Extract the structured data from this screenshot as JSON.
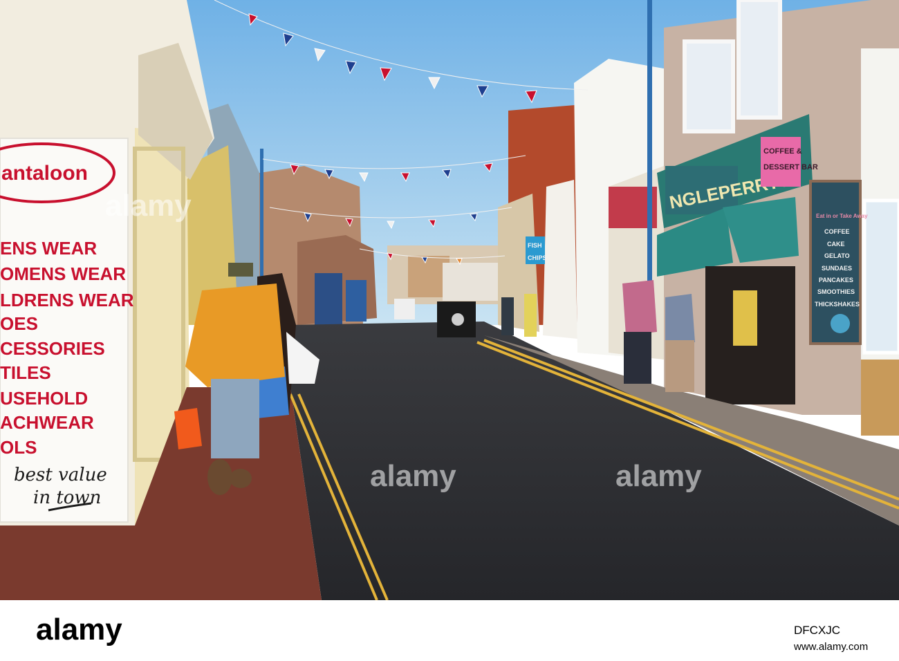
{
  "scene": {
    "left_shop_sign": {
      "name": "antaloon",
      "departments": [
        "ENS WEAR",
        "OMENS WEAR",
        "LDRENS WEAR",
        "OES",
        "CESSORIES",
        "TILES",
        "USEHOLD",
        "ACHWEAR",
        "OLS"
      ],
      "slogan_line1": "best value",
      "slogan_line2": "in town"
    },
    "cafe_sign": {
      "name": "NGLEPERRYS",
      "side_top": "COFFEE &",
      "side_bottom": "DESSERT BAR"
    },
    "cafe_menu_board": {
      "heading": "Eat in or Take Away",
      "items": [
        "COFFEE",
        "CAKE",
        "GELATO",
        "SUNDAES",
        "PANCAKES",
        "SMOOTHIES",
        "THICKSHAKES"
      ]
    },
    "fish_sign": {
      "line1": "FISH",
      "line2": "CHIPS"
    },
    "colors": {
      "sky": "#8ec4ea",
      "road": "#2e2f33",
      "sweater": "#e89a26",
      "cafe_facade": "#2a7a73"
    }
  },
  "watermark": {
    "text": "alamy"
  },
  "footer": {
    "logo": "alamy",
    "image_id": "DFCXJC",
    "site": "www.alamy.com"
  }
}
